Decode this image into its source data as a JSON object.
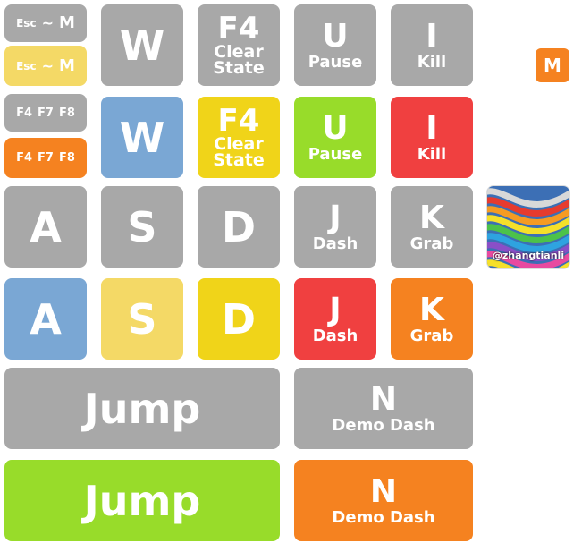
{
  "colors": {
    "gray": "#a8a8a8",
    "blue": "#7aa7d4",
    "light_yellow": "#f4d966",
    "yellow": "#f0d419",
    "green": "#98dc2a",
    "red": "#f04040",
    "orange": "#f58220"
  },
  "keys": {
    "esc_row_gray": {
      "esc": "Esc",
      "tilde": "~",
      "m": "M"
    },
    "esc_row_yellow": {
      "esc": "Esc",
      "tilde": "~",
      "m": "M"
    },
    "fkeys_gray": {
      "f4": "F4",
      "f7": "F7",
      "f8": "F8"
    },
    "fkeys_orange": {
      "f4": "F4",
      "f7": "F7",
      "f8": "F8"
    },
    "w": "W",
    "f4": {
      "key": "F4",
      "line1": "Clear",
      "line2": "State"
    },
    "u": {
      "key": "U",
      "label": "Pause"
    },
    "i": {
      "key": "I",
      "label": "Kill"
    },
    "a": "A",
    "s": "S",
    "d": "D",
    "j": {
      "key": "J",
      "label": "Dash"
    },
    "k": {
      "key": "K",
      "label": "Grab"
    },
    "jump": "Jump",
    "n": {
      "key": "N",
      "label": "Demo Dash"
    }
  },
  "logo": {
    "letter": "M"
  },
  "avatar": {
    "caption": "@zhangtianli"
  }
}
